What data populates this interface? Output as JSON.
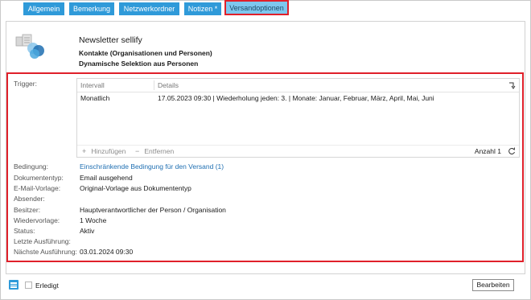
{
  "tabs": [
    {
      "label": "Allgemein"
    },
    {
      "label": "Bemerkung"
    },
    {
      "label": "Netzwerkordner"
    },
    {
      "label": "Notizen *"
    },
    {
      "label": "Versandoptionen"
    }
  ],
  "header": {
    "icon": "newsletter-icon",
    "title": "Newsletter sellify",
    "subtitle1": "Kontakte (Organisationen und Personen)",
    "subtitle2": "Dynamische Selektion aus Personen"
  },
  "trigger": {
    "label": "Trigger:",
    "columns": [
      "Intervall",
      "Details"
    ],
    "rows": [
      {
        "interval": "Monatlich",
        "details": "17.05.2023 09:30 | Wiederholung jeden: 3. | Monate: Januar, Februar, März, April, Mai, Juni"
      }
    ],
    "add_label": "Hinzufügen",
    "remove_label": "Entfernen",
    "count_label": "Anzahl 1"
  },
  "fields": [
    {
      "label": "Bedingung:",
      "value": "Einschränkende Bedingung für den Versand (1)",
      "link": true
    },
    {
      "label": "Dokumententyp:",
      "value": "Email ausgehend"
    },
    {
      "label": "E-Mail-Vorlage:",
      "value": "Original-Vorlage aus Dokumententyp"
    },
    {
      "label": "Absender:",
      "value": ""
    },
    {
      "label": "Besitzer:",
      "value": "Hauptverantwortlicher der Person / Organisation"
    },
    {
      "label": "Wiedervorlage:",
      "value": "1 Woche"
    },
    {
      "label": "Status:",
      "value": "Aktiv"
    },
    {
      "label": "Letzte Ausführung:",
      "value": ""
    },
    {
      "label": "Nächste Ausführung:",
      "value": "03.01.2024 09:30"
    }
  ],
  "footer": {
    "done_label": "Erledigt",
    "edit_label": "Bearbeiten"
  },
  "colors": {
    "tab": "#2f9ad9",
    "active_tab": "#7ec7ee",
    "highlight": "#e0202a",
    "link": "#1f6fb2"
  }
}
